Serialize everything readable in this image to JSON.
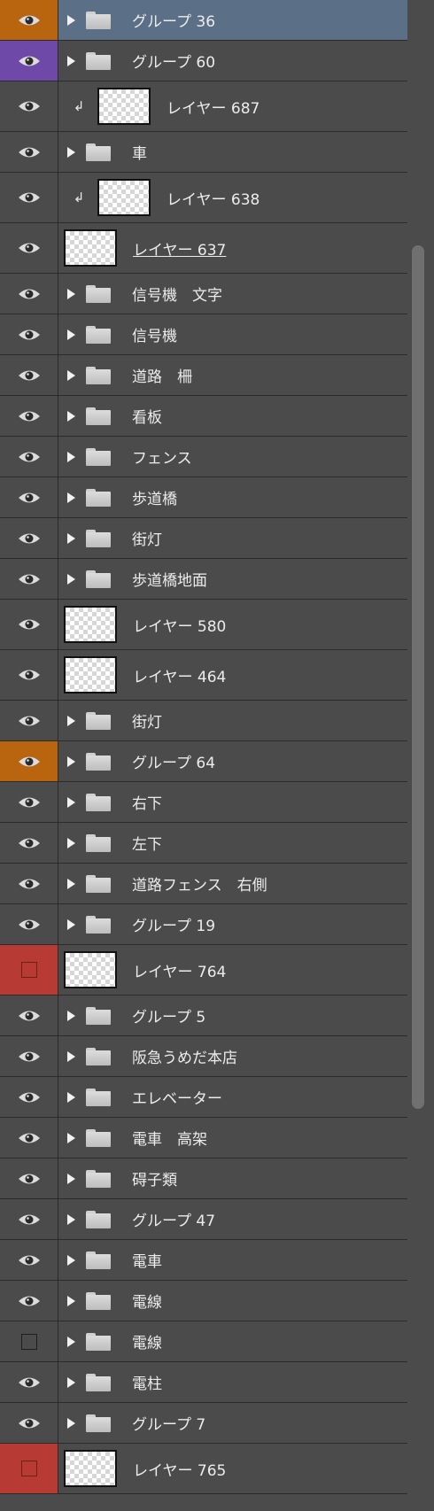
{
  "scrollbar": {
    "position": 0.16
  },
  "layers": [
    {
      "kind": "group",
      "name": "グループ 36",
      "marker": "orange",
      "selected": true
    },
    {
      "kind": "group",
      "name": "グループ 60",
      "marker": "purple"
    },
    {
      "kind": "clip",
      "name": "レイヤー 687"
    },
    {
      "kind": "group",
      "name": "車"
    },
    {
      "kind": "clip",
      "name": "レイヤー 638"
    },
    {
      "kind": "layer",
      "name": "レイヤー 637",
      "underline": true
    },
    {
      "kind": "group",
      "name": "信号機　文字"
    },
    {
      "kind": "group",
      "name": "信号機"
    },
    {
      "kind": "group",
      "name": "道路　柵"
    },
    {
      "kind": "group",
      "name": "看板"
    },
    {
      "kind": "group",
      "name": "フェンス"
    },
    {
      "kind": "group",
      "name": "歩道橋"
    },
    {
      "kind": "group",
      "name": "街灯"
    },
    {
      "kind": "group",
      "name": "歩道橋地面"
    },
    {
      "kind": "layer",
      "name": "レイヤー 580"
    },
    {
      "kind": "layer",
      "name": "レイヤー 464"
    },
    {
      "kind": "group",
      "name": "街灯"
    },
    {
      "kind": "group",
      "name": "グループ 64",
      "marker": "orange"
    },
    {
      "kind": "group",
      "name": "右下"
    },
    {
      "kind": "group",
      "name": "左下"
    },
    {
      "kind": "group",
      "name": "道路フェンス　右側"
    },
    {
      "kind": "group",
      "name": "グループ 19"
    },
    {
      "kind": "layer",
      "name": "レイヤー 764",
      "marker": "red",
      "hidden": true
    },
    {
      "kind": "group",
      "name": "グループ 5"
    },
    {
      "kind": "group",
      "name": "阪急うめだ本店"
    },
    {
      "kind": "group",
      "name": "エレベーター"
    },
    {
      "kind": "group",
      "name": "電車　高架"
    },
    {
      "kind": "group",
      "name": "碍子類"
    },
    {
      "kind": "group",
      "name": "グループ 47"
    },
    {
      "kind": "group",
      "name": "電車"
    },
    {
      "kind": "group",
      "name": "電線"
    },
    {
      "kind": "group",
      "name": "電線",
      "hidden": true
    },
    {
      "kind": "group",
      "name": "電柱"
    },
    {
      "kind": "group",
      "name": "グループ 7"
    },
    {
      "kind": "layer",
      "name": "レイヤー 765",
      "marker": "red",
      "hidden": true
    }
  ]
}
